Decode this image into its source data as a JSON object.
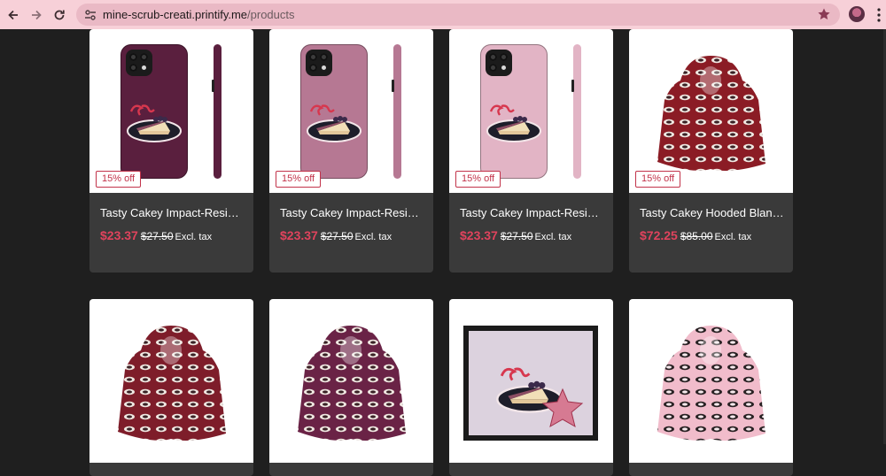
{
  "browser": {
    "url_host": "mine-scrub-creati.printify.me",
    "url_path": "/products"
  },
  "icons": {
    "back": "arrow-left-icon",
    "forward": "arrow-right-icon",
    "reload": "reload-icon",
    "site_info": "tune-icon",
    "bookmark": "star-icon",
    "profile": "avatar",
    "menu": "more-vert-icon"
  },
  "colors": {
    "toolbar_bg": "#f7d0d8",
    "omnibox_bg": "#eab9c5",
    "page_bg": "#1f1f1f",
    "card_bg": "#3a3a3a",
    "sale_price": "#e0435d",
    "badge": "#c2334a"
  },
  "products": [
    {
      "name": "Tasty Cakey Impact-Resistan...",
      "price": "$23.37",
      "compare_price": "$27.50",
      "tax": "Excl. tax",
      "badge": "15% off",
      "kind": "phone-case",
      "color": "#5a1f3e"
    },
    {
      "name": "Tasty Cakey Impact-Resistan...",
      "price": "$23.37",
      "compare_price": "$27.50",
      "tax": "Excl. tax",
      "badge": "15% off",
      "kind": "phone-case",
      "color": "#b67893"
    },
    {
      "name": "Tasty Cakey Impact-Resistan...",
      "price": "$23.37",
      "compare_price": "$27.50",
      "tax": "Excl. tax",
      "badge": "15% off",
      "kind": "phone-case",
      "color": "#e2b4c5"
    },
    {
      "name": "Tasty Cakey Hooded Blanket ...",
      "price": "$72.25",
      "compare_price": "$85.00",
      "tax": "Excl. tax",
      "badge": "15% off",
      "kind": "hooded-blanket",
      "color": "#8b1c25"
    },
    {
      "name": "",
      "badge": "",
      "kind": "hooded-blanket",
      "color": "#7e1d2a"
    },
    {
      "name": "",
      "badge": "",
      "kind": "hooded-blanket",
      "color": "#6a2346"
    },
    {
      "name": "",
      "badge": "",
      "kind": "framed-print",
      "color": "#d9cfdc"
    },
    {
      "name": "",
      "badge": "",
      "kind": "hooded-blanket",
      "color": "#f1bccb"
    }
  ]
}
